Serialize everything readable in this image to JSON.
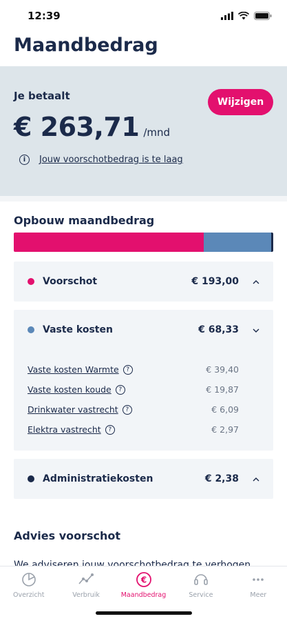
{
  "status_bar": {
    "time": "12:39"
  },
  "page_title": "Maandbedrag",
  "payment": {
    "label": "Je betaalt",
    "amount": "€ 263,71",
    "unit": "/mnd",
    "edit_button": "Wijzigen",
    "warning_text": "Jouw voorschotbedrag is te laag"
  },
  "breakdown": {
    "title": "Opbouw maandbedrag",
    "bar": [
      {
        "name": "Voorschot",
        "value": 193.0,
        "color": "#e3106e"
      },
      {
        "name": "Vaste kosten",
        "value": 68.33,
        "color": "#5b88b8"
      },
      {
        "name": "Administratiekosten",
        "value": 2.38,
        "color": "#1b2a4a"
      }
    ],
    "voorschot": {
      "label": "Voorschot",
      "amount": "€ 193,00",
      "color": "#e3106e"
    },
    "vaste_kosten": {
      "label": "Vaste kosten",
      "amount": "€ 68,33",
      "color": "#5b88b8",
      "items": [
        {
          "label": "Vaste kosten Warmte",
          "amount": "€ 39,40"
        },
        {
          "label": "Vaste kosten koude",
          "amount": "€ 19,87"
        },
        {
          "label": "Drinkwater vastrecht",
          "amount": "€ 6,09"
        },
        {
          "label": "Elektra vastrecht",
          "amount": "€ 2,97"
        }
      ]
    },
    "admin": {
      "label": "Administratiekosten",
      "amount": "€ 2,38",
      "color": "#1b2a4a"
    }
  },
  "advice": {
    "title": "Advies voorschot",
    "text": "We adviseren jouw voorschotbedrag te verhogen"
  },
  "tabs": [
    {
      "label": "Overzicht",
      "icon": "pie-chart-icon"
    },
    {
      "label": "Verbruik",
      "icon": "line-graph-icon"
    },
    {
      "label": "Maandbedrag",
      "icon": "euro-circle-icon",
      "active": true
    },
    {
      "label": "Service",
      "icon": "headset-icon"
    },
    {
      "label": "Meer",
      "icon": "more-dots-icon"
    }
  ]
}
